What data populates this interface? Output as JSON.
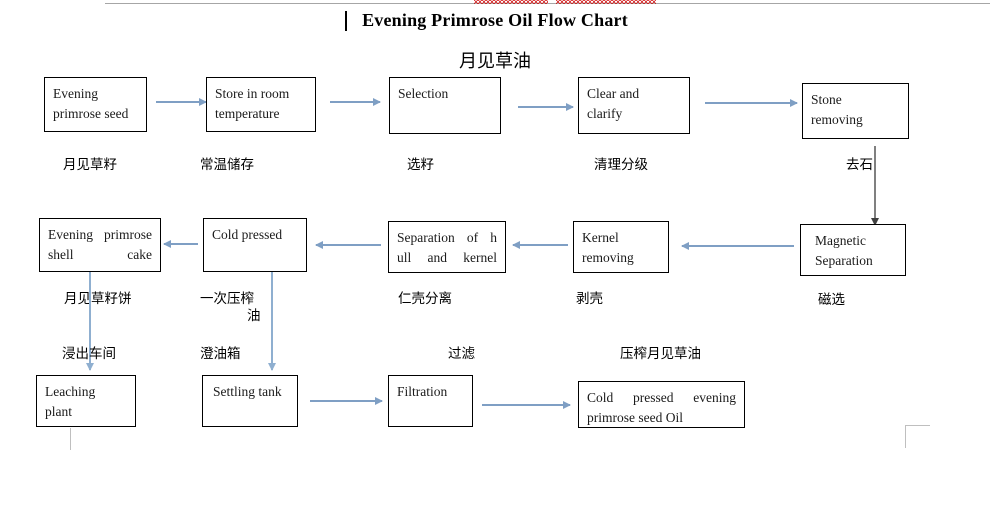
{
  "document": {
    "title_en": "Evening Primrose Oil Flow Chart",
    "title_cn": "月见草油"
  },
  "chart_data": {
    "type": "diagram",
    "title": "Evening Primrose Oil Flow Chart",
    "subtitle": "月见草油",
    "nodes": [
      {
        "id": "n1",
        "label_en": "Evening primrose seed",
        "label_cn": "月见草籽",
        "row": 1,
        "col": 1
      },
      {
        "id": "n2",
        "label_en": "Store in room temperature",
        "label_cn": "常温储存",
        "row": 1,
        "col": 2
      },
      {
        "id": "n3",
        "label_en": "Selection",
        "label_cn": "选籽",
        "row": 1,
        "col": 3
      },
      {
        "id": "n4",
        "label_en": "Clear and clarify",
        "label_cn": "清理分级",
        "row": 1,
        "col": 4
      },
      {
        "id": "n5",
        "label_en": "Stone removing",
        "label_cn": "去石",
        "row": 1,
        "col": 5
      },
      {
        "id": "n6",
        "label_en": "Magnetic Separation",
        "label_cn": "磁选",
        "row": 2,
        "col": 5
      },
      {
        "id": "n7",
        "label_en": "Kernel removing",
        "label_cn": "剥壳",
        "row": 2,
        "col": 4
      },
      {
        "id": "n8",
        "label_en": "Separation of hull and kernel",
        "label_cn": "仁壳分离",
        "row": 2,
        "col": 3
      },
      {
        "id": "n9",
        "label_en": "Cold pressed",
        "label_cn": "一次压榨油",
        "row": 2,
        "col": 2
      },
      {
        "id": "n10",
        "label_en": "Evening primrose shell cake",
        "label_cn": "月见草籽饼",
        "row": 2,
        "col": 1
      },
      {
        "id": "n11",
        "label_en": "Leaching plant",
        "label_cn": "浸出车间",
        "row": 3,
        "col": 1
      },
      {
        "id": "n12",
        "label_en": "Settling tank",
        "label_cn": "澄油箱",
        "row": 3,
        "col": 2
      },
      {
        "id": "n13",
        "label_en": "Filtration",
        "label_cn": "过滤",
        "row": 3,
        "col": 3
      },
      {
        "id": "n14",
        "label_en": "Cold pressed evening primrose seed Oil",
        "label_cn": "压榨月见草油",
        "row": 3,
        "col": 4
      }
    ],
    "edges": [
      {
        "from": "n1",
        "to": "n2",
        "direction": "right"
      },
      {
        "from": "n2",
        "to": "n3",
        "direction": "right"
      },
      {
        "from": "n3",
        "to": "n4",
        "direction": "right"
      },
      {
        "from": "n4",
        "to": "n5",
        "direction": "right"
      },
      {
        "from": "n5",
        "to": "n6",
        "direction": "down"
      },
      {
        "from": "n6",
        "to": "n7",
        "direction": "left"
      },
      {
        "from": "n7",
        "to": "n8",
        "direction": "left"
      },
      {
        "from": "n8",
        "to": "n9",
        "direction": "left"
      },
      {
        "from": "n9",
        "to": "n10",
        "direction": "left"
      },
      {
        "from": "n10",
        "to": "n11",
        "direction": "down"
      },
      {
        "from": "n9",
        "to": "n12",
        "direction": "down"
      },
      {
        "from": "n12",
        "to": "n13",
        "direction": "right"
      },
      {
        "from": "n13",
        "to": "n14",
        "direction": "right"
      }
    ],
    "colors": {
      "arrow_blue": "#7f9fc4",
      "arrow_gray": "#808080",
      "box_border": "#000000",
      "text": "#1a1a1a",
      "rule": "#a6a6a6",
      "spellcheck_red": "#cc0000"
    }
  },
  "boxes": {
    "b1": {
      "line1": "Evening",
      "line2": "primrose seed"
    },
    "b2": {
      "line1": "Store  in  room",
      "line2": "temperature"
    },
    "b3": {
      "line1": "Selection"
    },
    "b4": {
      "line1": "Clear            and",
      "line2": "clarify"
    },
    "b5": {
      "line1": "Stone",
      "line2": "removing"
    },
    "b6": {
      "line1": "Magnetic",
      "line2": "Separation"
    },
    "b7": {
      "line1": "Kernel",
      "line2": "removing"
    },
    "b8": {
      "line1": "Separation  of  h",
      "line2": "ull  and  kernel"
    },
    "b9": {
      "line1": "Cold pressed"
    },
    "b10": {
      "line1": "Evening    primrose",
      "line2": "shell cake"
    },
    "b11": {
      "line1": "Leaching",
      "line2": "plant"
    },
    "b12": {
      "line1": "Settling tank"
    },
    "b13": {
      "line1": "Filtration"
    },
    "b14": {
      "line1": "Cold     pressed     evening",
      "line2": "primrose seed Oil"
    }
  },
  "labels": {
    "l1": "月见草籽",
    "l2": "常温储存",
    "l3": "选籽",
    "l4": "清理分级",
    "l5": "去石",
    "l6": "磁选",
    "l7": "剥壳",
    "l8": "仁壳分离",
    "l9a": "一次压榨",
    "l9b": "油",
    "l10": "月见草籽饼",
    "l11": "浸出车间",
    "l12": "澄油箱",
    "l13": "过滤",
    "l14": "压榨月见草油"
  }
}
